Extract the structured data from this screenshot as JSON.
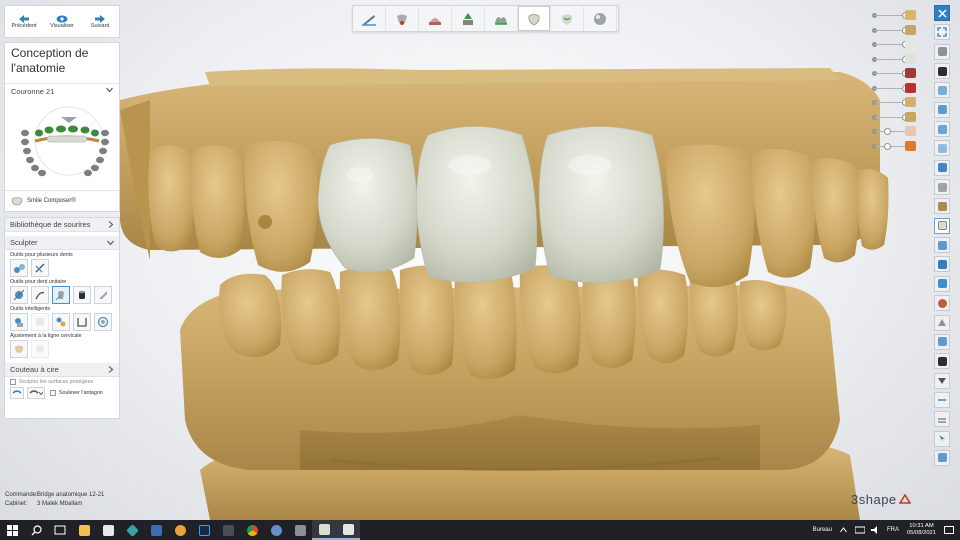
{
  "nav": {
    "prev": "Précédent",
    "view": "Visualiser",
    "next": "Suivant"
  },
  "anatomy": {
    "title": "Conception de l'anatomie",
    "crown_label": "Couronne 21",
    "smile_composer": "Smile Composer®"
  },
  "sculpt_panel": {
    "library_label": "Bibliothèque de sourires",
    "sculpt_label": "Sculpter",
    "multi_tooth_label": "Outils pour plusieurs dents",
    "single_tooth_label": "Outils pour dent unitaire",
    "smart_tools_label": "Outils intelligents",
    "cervical_label": "Ajustement à la ligne cervicale",
    "wax_knife_label": "Couteau à cire",
    "protected_surfaces_label": "Sculpter les surfaces protégées",
    "lift_antagonist_label": "Soulever l'antagon"
  },
  "status": {
    "command_key": "Commande:",
    "command_value": "Bridge anatomique 12-21",
    "office_key": "Cabinet:",
    "office_value": "3 Malek Mballam"
  },
  "logo": "3shape",
  "icons": {
    "top_toolbar": [
      "margin-line-icon",
      "preparation-icon",
      "die-icon",
      "insertion-icon",
      "gingiva-icon",
      "anatomy-icon",
      "cutback-icon",
      "sphere-icon"
    ],
    "right_toolbar": [
      "close-icon",
      "fit-view-icon",
      "layers-icon",
      "gallery-icon",
      "layer-copy-icon",
      "duplicate-icon",
      "stack-icon",
      "panel-icon",
      "window-icon",
      "settings-icon",
      "cutter-icon",
      "tooth-side-icon",
      "tooth-view-icon",
      "jaw-icon",
      "cube-icon",
      "avatar-icon",
      "triangle-icon",
      "grid-icon",
      "camera-icon",
      "down-arrow-icon",
      "line-icon",
      "line-icon",
      "cursor-icon",
      "screenshot-icon"
    ]
  },
  "taskbar": {
    "tray_label": "Bureau",
    "lang": "FRA",
    "time": "10:31 AM",
    "date": "05/08/2021"
  },
  "colors": {
    "model": "#c9a563",
    "crown": "#d9ddd0",
    "accent": "#2f7fc1"
  }
}
